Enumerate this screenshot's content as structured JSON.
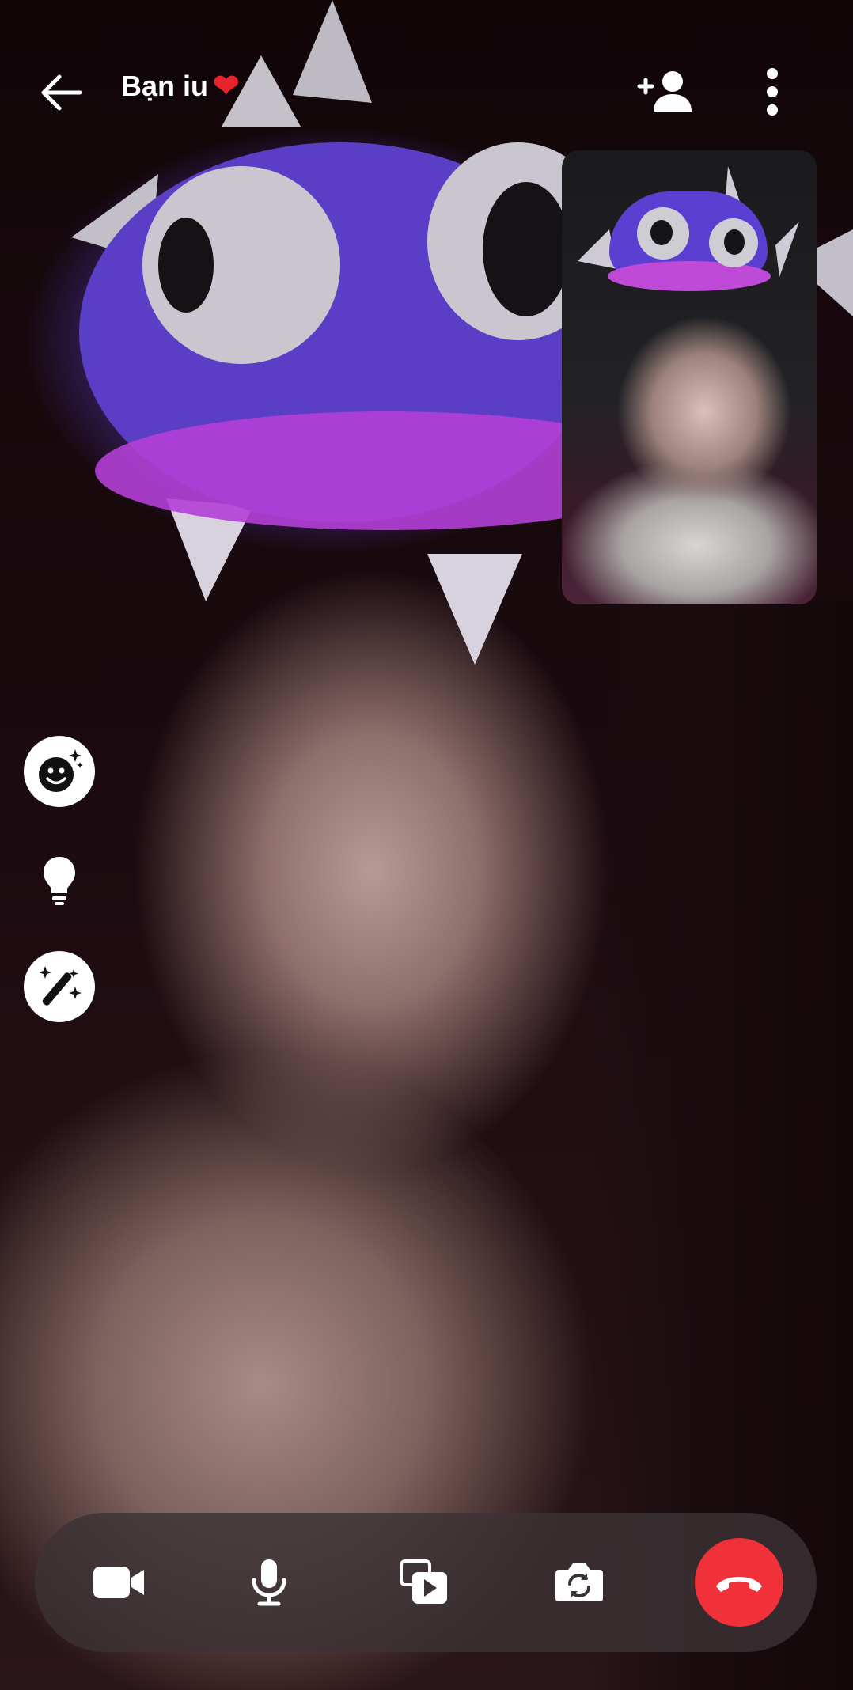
{
  "call": {
    "contact_name": "Bạn iu",
    "contact_emoji": "❤",
    "back_icon": "arrow-left-icon",
    "add_person_icon": "add-person-icon",
    "more_icon": "more-vertical-icon"
  },
  "side_tools": [
    {
      "icon": "face-sparkle-icon",
      "style": "filled"
    },
    {
      "icon": "lightbulb-icon",
      "style": "plain"
    },
    {
      "icon": "magic-wand-icon",
      "style": "filled"
    }
  ],
  "controls": [
    {
      "icon": "video-camera-icon"
    },
    {
      "icon": "microphone-icon"
    },
    {
      "icon": "share-media-icon"
    },
    {
      "icon": "flip-camera-icon"
    },
    {
      "icon": "end-call-icon",
      "color": "#f0313a"
    }
  ],
  "colors": {
    "end_call": "#f0313a",
    "control_bar": "#3c3234"
  }
}
